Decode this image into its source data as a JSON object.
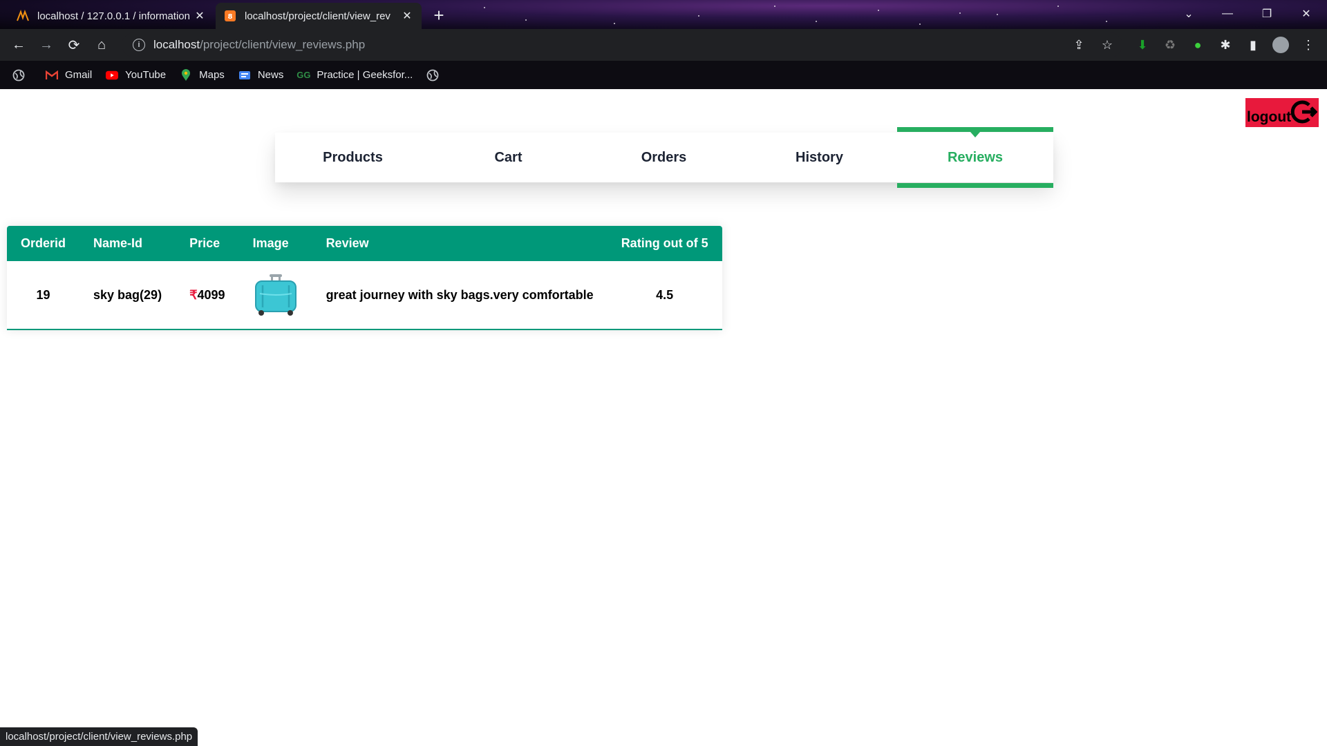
{
  "browser": {
    "tabs": [
      {
        "title": "localhost / 127.0.0.1 / information",
        "active": false,
        "icon": "phpmyadmin-icon"
      },
      {
        "title": "localhost/project/client/view_rev",
        "active": true,
        "icon": "xampp-icon"
      }
    ],
    "url_host": "localhost",
    "url_path": "/project/client/view_reviews.php",
    "bookmarks": [
      {
        "label": "Gmail",
        "icon": "gmail-icon"
      },
      {
        "label": "YouTube",
        "icon": "youtube-icon"
      },
      {
        "label": "Maps",
        "icon": "maps-icon"
      },
      {
        "label": "News",
        "icon": "news-icon"
      },
      {
        "label": "Practice | Geeksfor...",
        "icon": "geeksforgeeks-icon"
      }
    ],
    "status_url": "localhost/project/client/view_reviews.php"
  },
  "page": {
    "logout_label": "logout",
    "nav": {
      "items": [
        {
          "label": "Products"
        },
        {
          "label": "Cart"
        },
        {
          "label": "Orders"
        },
        {
          "label": "History"
        },
        {
          "label": "Reviews"
        }
      ],
      "active_index": 4,
      "accent_color": "#27ae60"
    },
    "table": {
      "header_color": "#009879",
      "columns": [
        "Orderid",
        "Name-Id",
        "Price",
        "Image",
        "Review",
        "Rating out of 5"
      ],
      "rows": [
        {
          "orderid": "19",
          "name_id": "sky bag(29)",
          "currency": "₹",
          "price": "4099",
          "image": "blue-trolley-bag",
          "review": "great journey with sky bags.very comfortable",
          "rating": "4.5"
        }
      ]
    }
  }
}
